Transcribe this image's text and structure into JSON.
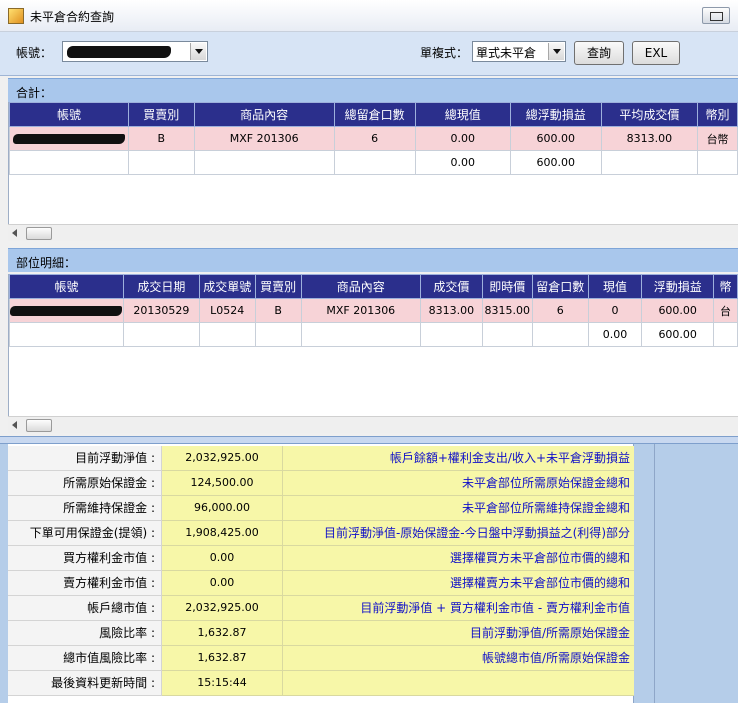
{
  "window": {
    "title": "未平倉合約查詢"
  },
  "toolbar": {
    "account_label": "帳號：",
    "type_label": "單複式：",
    "type_value": "單式未平倉",
    "query_button": "查詢",
    "exl_button": "EXL"
  },
  "totals": {
    "section_title": "合計：",
    "columns": [
      "帳號",
      "買賣別",
      "商品內容",
      "總留倉口數",
      "總現值",
      "總浮動損益",
      "平均成交價",
      "幣別"
    ],
    "rows": [
      [
        "",
        "B",
        "MXF 201306",
        "6",
        "0.00",
        "600.00",
        "8313.00",
        "台幣"
      ],
      [
        "",
        "",
        "",
        "",
        "0.00",
        "600.00",
        "",
        ""
      ]
    ]
  },
  "detail": {
    "section_title": "部位明細：",
    "columns": [
      "帳號",
      "成交日期",
      "成交單號",
      "買賣別",
      "商品內容",
      "成交價",
      "即時價",
      "留倉口數",
      "現值",
      "浮動損益",
      "幣"
    ],
    "rows": [
      [
        "",
        "20130529",
        "L0524",
        "B",
        "MXF 201306",
        "8313.00",
        "8315.00",
        "6",
        "0",
        "600.00",
        "台"
      ],
      [
        "",
        "",
        "",
        "",
        "",
        "",
        "",
        "",
        "0.00",
        "600.00",
        ""
      ]
    ]
  },
  "summary": {
    "rows": [
      {
        "label": "目前浮動淨值 :",
        "value": "2,032,925.00",
        "desc": "帳戶餘額+權利金支出/收入+未平倉浮動損益"
      },
      {
        "label": "所需原始保證金 :",
        "value": "124,500.00",
        "desc": "未平倉部位所需原始保證金總和"
      },
      {
        "label": "所需維持保證金 :",
        "value": "96,000.00",
        "desc": "未平倉部位所需維持保證金總和"
      },
      {
        "label": "下單可用保證金(提領) :",
        "value": "1,908,425.00",
        "desc": "目前浮動淨值-原始保證金-今日盤中浮動損益之(利得)部分"
      },
      {
        "label": "買方權利金市值 :",
        "value": "0.00",
        "desc": "選擇權買方未平倉部位市價的總和"
      },
      {
        "label": "賣方權利金市值 :",
        "value": "0.00",
        "desc": "選擇權賣方未平倉部位市價的總和"
      },
      {
        "label": "帳戶總市值 :",
        "value": "2,032,925.00",
        "desc": "目前浮動淨值 + 買方權利金市值 - 賣方權利金市值"
      },
      {
        "label": "風險比率 :",
        "value": "1,632.87",
        "desc": "目前浮動淨值/所需原始保證金"
      },
      {
        "label": "總市值風險比率 :",
        "value": "1,632.87",
        "desc": "帳號總市值/所需原始保證金"
      },
      {
        "label": "最後資料更新時間 :",
        "value": "15:15:44",
        "desc": ""
      }
    ]
  },
  "colors": {
    "header_bg": "#2b2f8c",
    "highlight_row": "#f7d3d7",
    "summary_yellow": "#f7f7a8",
    "section_blue": "#a9c7ec",
    "desc_text": "#1010c8"
  }
}
